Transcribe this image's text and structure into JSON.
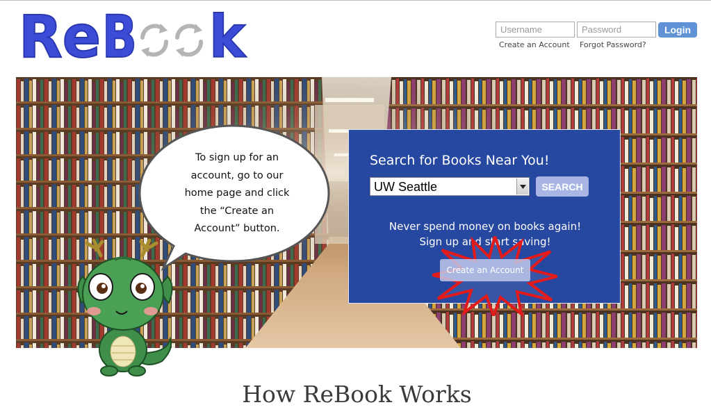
{
  "brand": {
    "logo_parts": [
      "Re",
      "B",
      "k"
    ]
  },
  "login": {
    "username_placeholder": "Username",
    "password_placeholder": "Password",
    "login_label": "Login",
    "create_account_link": "Create an Account",
    "forgot_password_link": "Forgot Password?"
  },
  "search": {
    "title": "Search for Books Near You!",
    "selected_location": "UW Seattle",
    "search_label": "SEARCH",
    "promo_line1": "Never spend money on books again!",
    "promo_line2": "Sign up and start saving!",
    "create_account_label": "Create an Account"
  },
  "tutorial": {
    "bubble_lines": [
      "To sign up for an",
      "account, go to our",
      "home page and click",
      "the “Create an",
      "Account” button."
    ]
  },
  "section": {
    "heading": "How ReBook Works"
  },
  "colors": {
    "logo_blue": "#3d4cd6",
    "login_button": "#5f93d6",
    "search_panel": "#2748a0",
    "starburst": "#e31b1b"
  }
}
